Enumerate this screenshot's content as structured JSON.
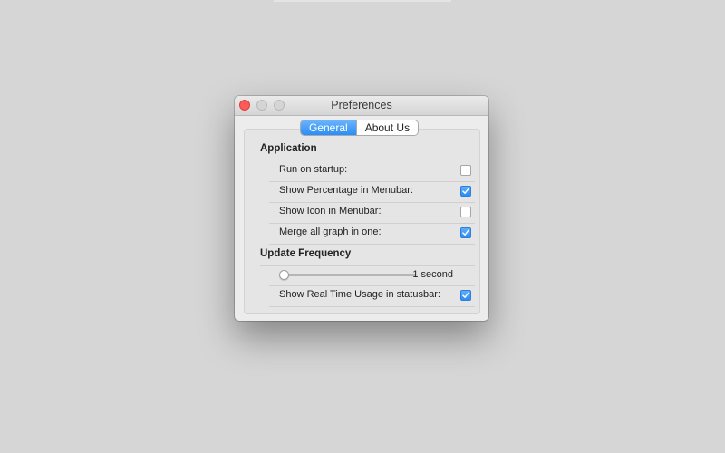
{
  "window": {
    "title": "Preferences"
  },
  "tabs": [
    {
      "label": "General",
      "active": true
    },
    {
      "label": "About Us",
      "active": false
    }
  ],
  "sections": {
    "application": {
      "title": "Application"
    },
    "update": {
      "title": "Update Frequency"
    }
  },
  "application_rows": [
    {
      "label": "Run on startup:",
      "checked": false
    },
    {
      "label": "Show Percentage in Menubar:",
      "checked": true
    },
    {
      "label": "Show Icon in Menubar:",
      "checked": false
    },
    {
      "label": "Merge all graph in one:",
      "checked": true
    }
  ],
  "update_frequency": {
    "slider_value_fraction": 0.0,
    "value_label": "1 second"
  },
  "statusbar_row": {
    "label": "Show Real Time Usage in statusbar:",
    "checked": true
  },
  "colors": {
    "accent": "#2a8ef7",
    "close_button": "#fc5b57",
    "background": "#d6d6d6"
  }
}
